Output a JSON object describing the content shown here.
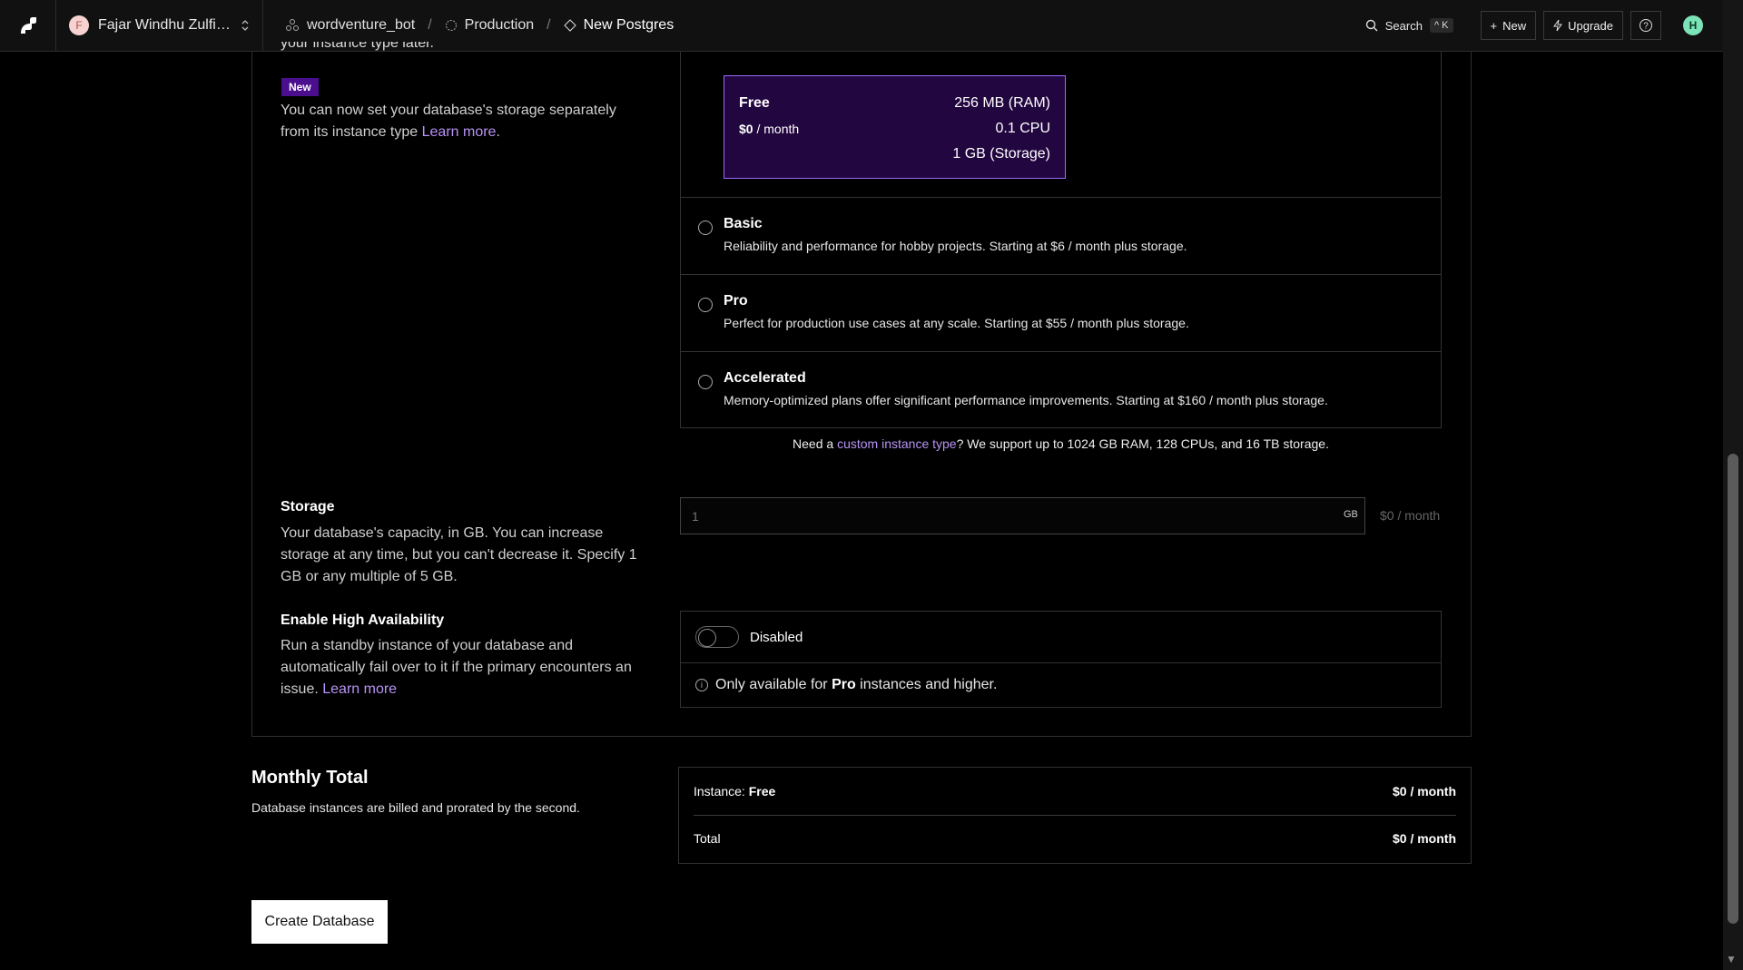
{
  "topbar": {
    "workspace_initial": "F",
    "workspace_name": "Fajar Windhu Zulfik...",
    "breadcrumbs": [
      {
        "label": "wordventure_bot"
      },
      {
        "label": "Production"
      },
      {
        "label": "New Postgres"
      }
    ],
    "search_label": "Search",
    "search_shortcut": "^ K",
    "new_label": "New",
    "upgrade_label": "Upgrade",
    "user_initial": "H"
  },
  "instance": {
    "cut_text": "your instance type later.",
    "new_badge": "New",
    "storage_note": "You can now set your database's storage separately from its instance type ",
    "storage_note_link": "Learn more",
    "storage_note_end": ".",
    "free": {
      "name": "Free",
      "ram": "256 MB (RAM)",
      "price": "$0",
      "price_suffix": " / month",
      "cpu": "0.1 CPU",
      "storage": "1 GB (Storage)"
    },
    "tiers": [
      {
        "name": "Basic",
        "desc": "Reliability and performance for hobby projects. Starting at $6 / month plus storage."
      },
      {
        "name": "Pro",
        "desc": "Perfect for production use cases at any scale. Starting at $55 / month plus storage."
      },
      {
        "name": "Accelerated",
        "desc": "Memory-optimized plans offer significant performance improvements. Starting at $160 / month plus storage."
      }
    ],
    "custom_prefix": "Need a ",
    "custom_link": "custom instance type",
    "custom_suffix": "? We support up to 1024 GB RAM, 128 CPUs, and 16 TB storage."
  },
  "storage": {
    "title": "Storage",
    "desc": "Your database's capacity, in GB. You can increase storage at any time, but you can't decrease it. Specify 1 GB or any multiple of 5 GB.",
    "placeholder": "1",
    "unit": "GB",
    "price": "$0 / month"
  },
  "ha": {
    "title": "Enable High Availability",
    "desc": "Run a standby instance of your database and automatically fail over to it if the primary encounters an issue. ",
    "desc_link": "Learn more",
    "toggle_label": "Disabled",
    "note_prefix": "Only available for ",
    "note_bold": "Pro",
    "note_suffix": " instances and higher."
  },
  "total": {
    "title": "Monthly Total",
    "subtitle": "Database instances are billed and prorated by the second.",
    "instance_label": "Instance: ",
    "instance_value": "Free",
    "instance_price": "$0 / month",
    "total_label": "Total",
    "total_price": "$0 / month"
  },
  "create_button": "Create Database"
}
